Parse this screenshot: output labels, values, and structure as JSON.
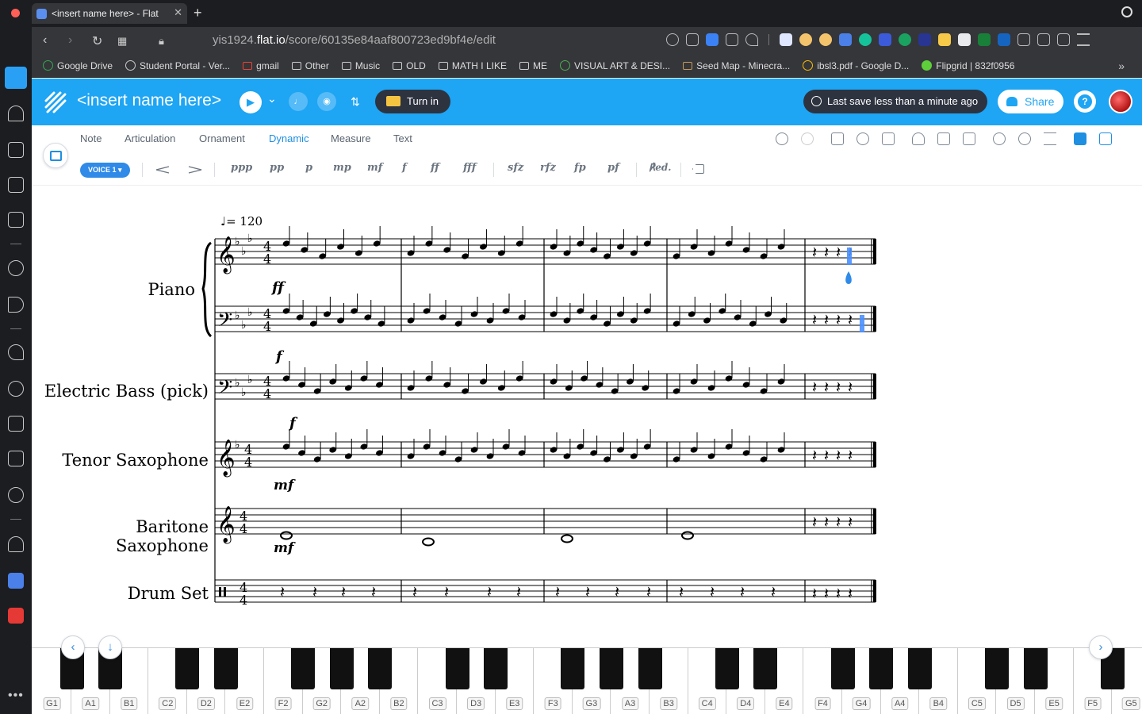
{
  "browser": {
    "tab_title": "<insert name here> - Flat",
    "url_prefix": "yis1924.",
    "url_domain": "flat.io",
    "url_path": "/score/60135e84aaf800723ed9bf4e/edit",
    "bookmarks": [
      "Google Drive",
      "Student Portal - Ver...",
      "gmail",
      "Other",
      "Music",
      "OLD",
      "MATH I LIKE",
      "ME",
      "VISUAL ART & DESI...",
      "Seed Map - Minecra...",
      "ibsl3.pdf - Google D...",
      "Flipgrid | 832f0956"
    ]
  },
  "header": {
    "score_title": "<insert name here>",
    "turn_in_label": "Turn in",
    "last_save": "Last save less than a minute ago",
    "share_label": "Share",
    "help_label": "?"
  },
  "menu": {
    "items": [
      "Note",
      "Articulation",
      "Ornament",
      "Dynamic",
      "Measure",
      "Text"
    ],
    "active": "Dynamic"
  },
  "dynamics_toolbar": {
    "voice_label": "VOICE 1 ▾",
    "hairpins": [
      "crescendo",
      "diminuendo"
    ],
    "marks": [
      "ppp",
      "pp",
      "p",
      "mp",
      "mf",
      "f",
      "ff",
      "fff",
      "sfz",
      "rfz",
      "fp",
      "pf",
      "℟ed.",
      "delete"
    ]
  },
  "score": {
    "tempo_text": "= 120",
    "instruments": [
      "Piano",
      "Electric Bass (pick)",
      "Tenor Saxophone",
      "Baritone Saxophone",
      "Drum Set"
    ],
    "dynamics": {
      "piano_treble": "ff",
      "piano_bass": "f",
      "bass": "f",
      "tenor": "mf",
      "baritone": "mf"
    },
    "time_signature": "4/4",
    "measures": 5
  },
  "keyboard": {
    "white_keys": [
      "G1",
      "A1",
      "B1",
      "C2",
      "D2",
      "E2",
      "F2",
      "G2",
      "A2",
      "B2",
      "C3",
      "D3",
      "E3",
      "F3",
      "G3",
      "A3",
      "B3",
      "C4",
      "D4",
      "E4",
      "F4",
      "G4",
      "A4",
      "B4",
      "C5",
      "D5",
      "E5",
      "F5",
      "G5"
    ]
  },
  "colors": {
    "brand_blue": "#1ea5f4",
    "accent": "#1e8fe1",
    "dark": "#2e3340",
    "selection": "#4a90ff"
  }
}
